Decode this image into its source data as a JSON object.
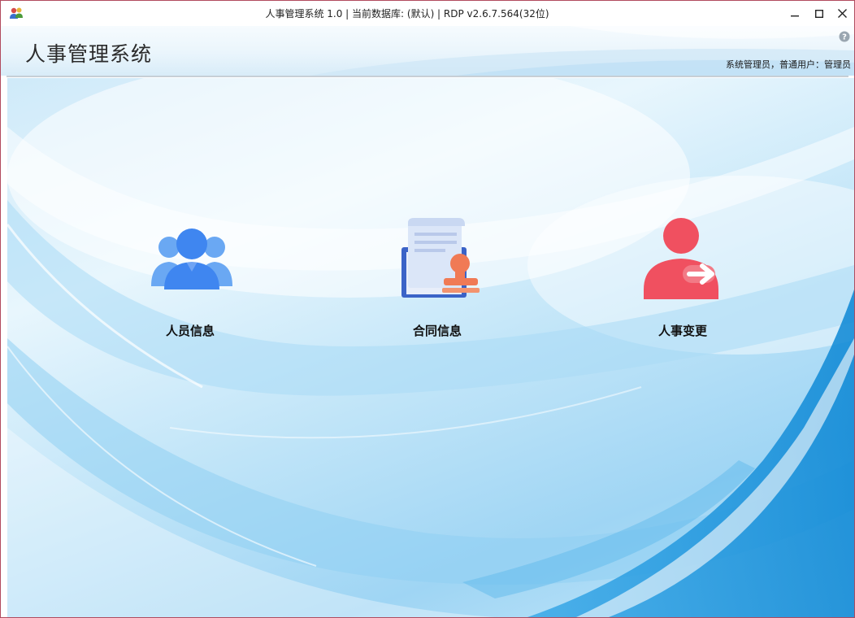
{
  "window": {
    "title": "人事管理系统 1.0 | 当前数据库: (默认) | RDP v2.6.7.564(32位)",
    "icon": "users-icon",
    "controls": [
      "minimize-icon",
      "maximize-icon",
      "close-icon"
    ]
  },
  "header": {
    "app_title": "人事管理系统",
    "user_info": "系统管理员，普通用户：管理员",
    "help_icon": "help-icon"
  },
  "tiles": [
    {
      "label": "人员信息",
      "icon": "people-icon",
      "color": "#3f86f0"
    },
    {
      "label": "合同信息",
      "icon": "contract-stamp-icon",
      "color": "#f07a55"
    },
    {
      "label": "人事变更",
      "icon": "person-transfer-icon",
      "color": "#f05060"
    }
  ],
  "colors": {
    "window_border": "#b14b5e",
    "background_light": "#e8f6fd",
    "background_deep": "#1e9be0"
  }
}
